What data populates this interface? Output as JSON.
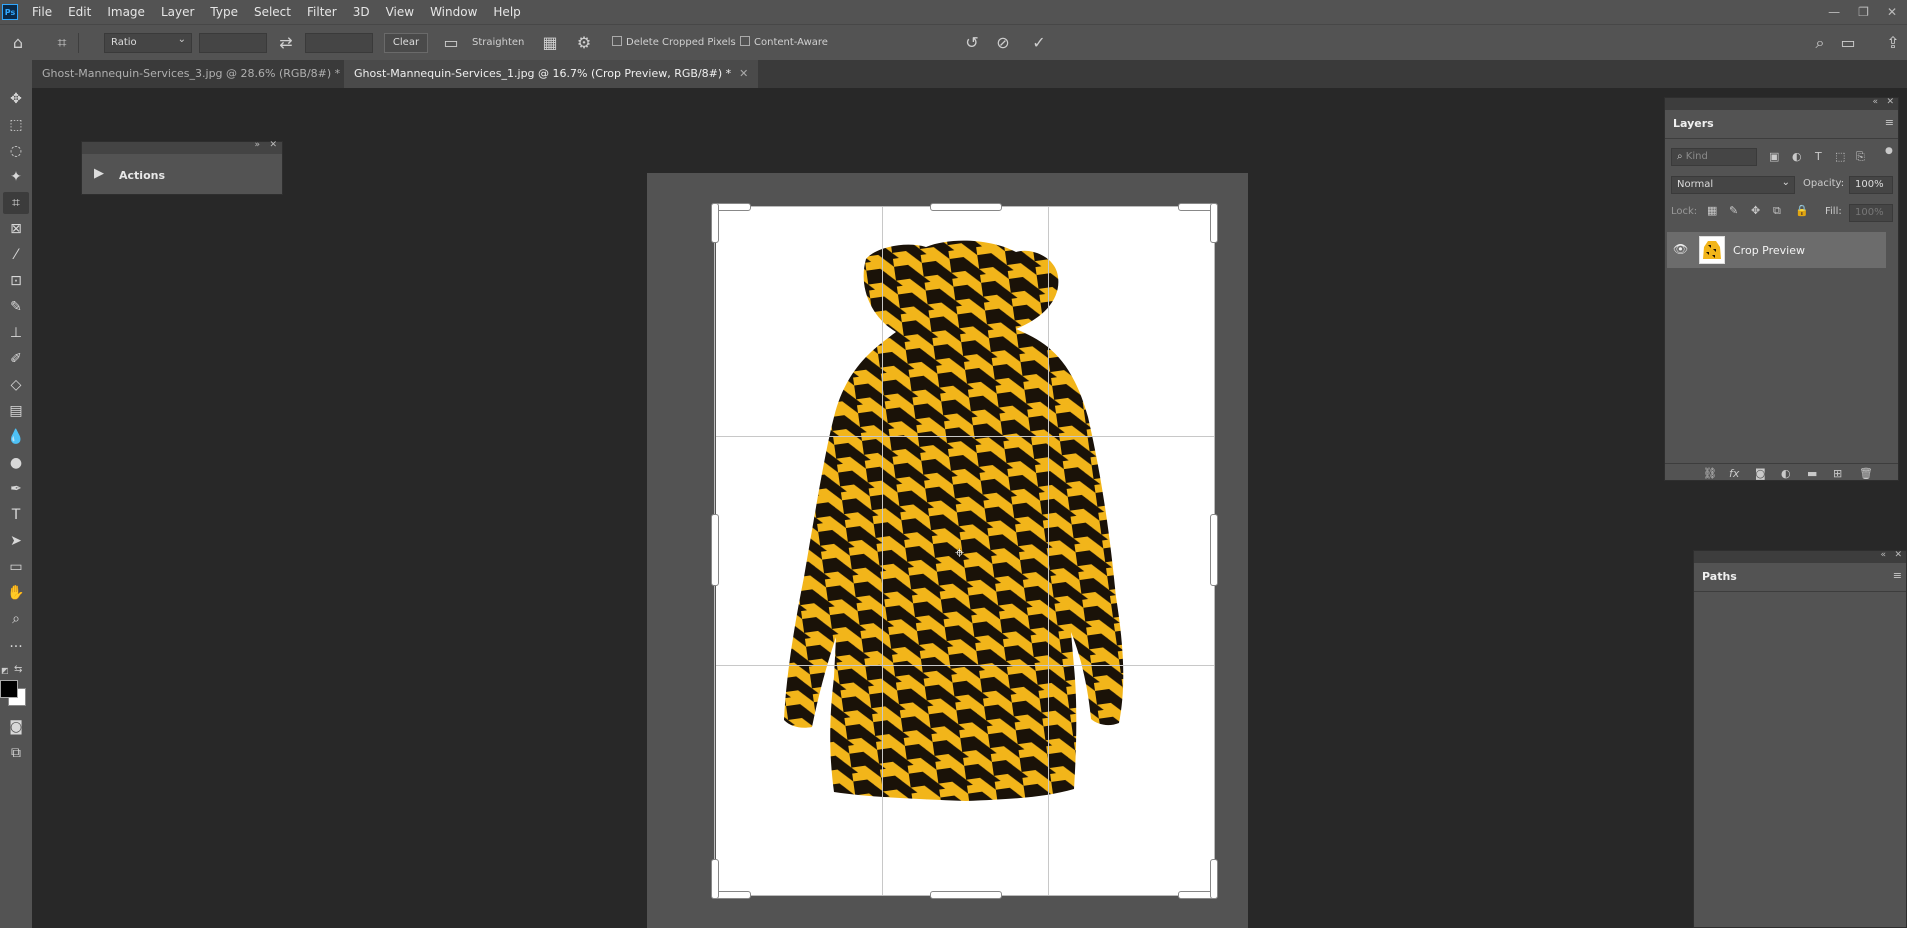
{
  "menubar": {
    "logo": "Ps",
    "items": [
      "File",
      "Edit",
      "Image",
      "Layer",
      "Type",
      "Select",
      "Filter",
      "3D",
      "View",
      "Window",
      "Help"
    ]
  },
  "options": {
    "ratio_value": "Ratio",
    "clear_label": "Clear",
    "straighten_label": "Straighten",
    "delete_cropped_label": "Delete Cropped Pixels",
    "content_aware_label": "Content-Aware"
  },
  "tabs": [
    {
      "label": "Ghost-Mannequin-Services_3.jpg @ 28.6% (RGB/8#) *"
    },
    {
      "label": "Ghost-Mannequin-Services_1.jpg @ 16.7% (Crop Preview, RGB/8#) *"
    }
  ],
  "actions_panel": {
    "title": "Actions"
  },
  "layers_panel": {
    "tab": "Layers",
    "filter_placeholder": "Kind",
    "blend_mode": "Normal",
    "opacity_label": "Opacity:",
    "opacity_value": "100%",
    "lock_label": "Lock:",
    "fill_label": "Fill:",
    "fill_value": "100%",
    "layer_name": "Crop Preview"
  },
  "paths_panel": {
    "tab": "Paths"
  },
  "colors": {
    "jacket_yellow": "#f2b51a",
    "jacket_black": "#1a1208",
    "ui_panel": "#535353",
    "workspace": "#282828"
  }
}
